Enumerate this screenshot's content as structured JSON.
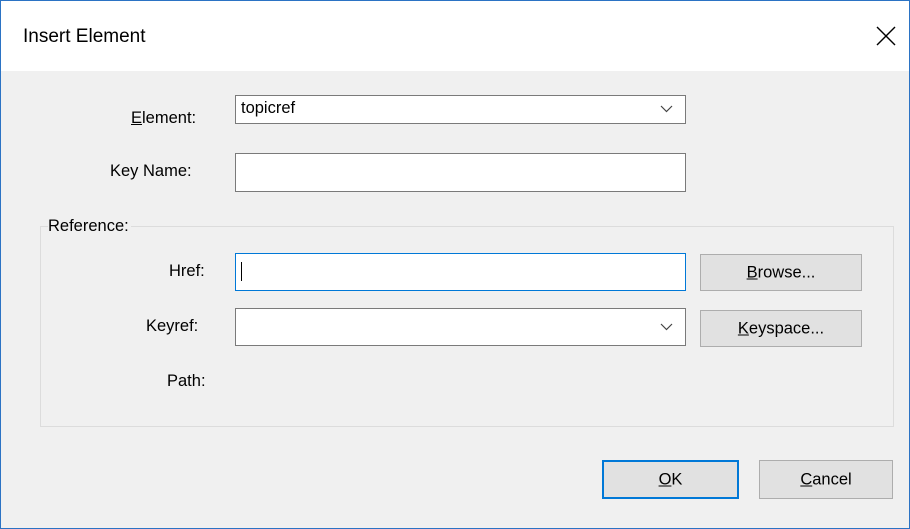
{
  "dialog": {
    "title": "Insert Element",
    "close_icon": "close-icon"
  },
  "element": {
    "label": "Element:",
    "value": "topicref"
  },
  "key_name": {
    "label": "Key Name:",
    "value": ""
  },
  "reference": {
    "group_label": "Reference:",
    "href_label": "Href:",
    "href_value": "",
    "browse_label": "Browse...",
    "keyref_label": "Keyref:",
    "keyref_value": "",
    "keyspace_label": "Keyspace...",
    "path_label": "Path:"
  },
  "footer": {
    "ok_label": "OK",
    "cancel_label": "Cancel"
  },
  "colors": {
    "accent": "#0078d7",
    "dialog_bg": "#f0f0f0",
    "window_border": "#2b73c4"
  }
}
